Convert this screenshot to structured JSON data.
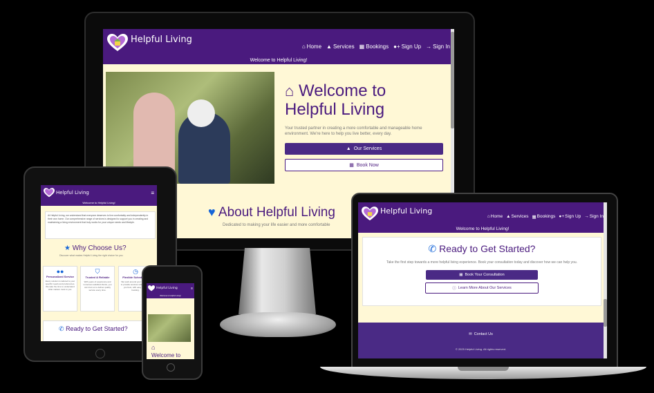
{
  "site": {
    "brand": "Helpful Living",
    "welcome_bar": "Welcome to Helpful Living!",
    "nav": [
      "Home",
      "Services",
      "Bookings",
      "Sign Up",
      "Sign In"
    ]
  },
  "monitor": {
    "hero_title_line1": "Welcome to",
    "hero_title_line2": "Helpful Living",
    "hero_text": "Your trusted partner in creating a more comfortable and manageable home environment. We're here to help you live better, every day.",
    "btn_services": "Our Services",
    "btn_book": "Book Now",
    "about_title": "About Helpful Living",
    "about_sub": "Dedicated to making your life easier and more comfortable"
  },
  "tablet": {
    "welcome_bar": "Welcome to Helpful Living!",
    "about_text": "At Helpful Living, we understand that everyone deserves to live comfortably and independently in their own home. Our comprehensive range of services is designed to support you in creating and maintaining a living environment that truly works for your unique needs and lifestyle.",
    "why_title": "Why Choose Us?",
    "why_sub": "Discover what makes Helpful Living the right choice for you",
    "cards": [
      {
        "title": "Personalized Service",
        "text": "Every solution is tailored to your specific needs and preferences. We take the time to understand what matters most to you."
      },
      {
        "title": "Trusted & Reliable",
        "text": "With years of experience and numerous satisfied clients, you can trust us to deliver quality service every time."
      },
      {
        "title": "Flexible Scheduling",
        "text": "We work around your schedule to provide services when it suits you best, with easy online booking."
      }
    ],
    "ready_title": "Ready to Get Started?"
  },
  "phone": {
    "welcome_bar": "Welcome to Helpful Living!",
    "hero_title": "Welcome to"
  },
  "laptop": {
    "ready_title": "Ready to Get Started?",
    "ready_text": "Take the first step towards a more helpful living experience. Book your consultation today and discover how we can help you.",
    "btn_consult": "Book Your Consultation",
    "btn_learn": "Learn More About Our Services",
    "contact": "Contact Us",
    "copyright": "© 2025 Helpful Living. All rights reserved."
  },
  "colors": {
    "purple": "#4a1a7e",
    "cream": "#fff8d6",
    "blue": "#1565d8"
  },
  "icons": [
    "heart-logo-icon",
    "house-icon",
    "hands-icon",
    "calendar-icon",
    "user-plus-icon",
    "sign-in-icon",
    "heart-icon",
    "phone-icon",
    "users-icon",
    "shield-icon",
    "clock-icon",
    "info-icon",
    "envelope-icon",
    "menu-icon"
  ]
}
